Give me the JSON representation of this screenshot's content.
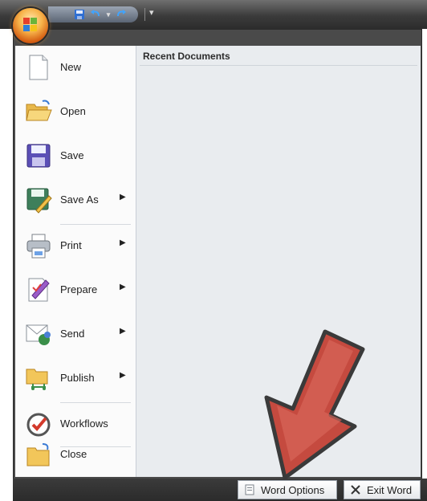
{
  "window": {
    "title": ""
  },
  "quick_access": {
    "items": [
      {
        "icon": "save-icon"
      },
      {
        "icon": "undo-icon"
      },
      {
        "icon": "undo-dropdown-icon"
      },
      {
        "icon": "redo-icon"
      },
      {
        "icon": "customize-qat-icon"
      }
    ]
  },
  "menu": {
    "items": [
      {
        "label": "New",
        "icon": "new-document-icon",
        "submenu": false
      },
      {
        "label": "Open",
        "icon": "open-folder-icon",
        "submenu": false
      },
      {
        "label": "Save",
        "icon": "save-disk-icon",
        "submenu": false
      },
      {
        "label": "Save As",
        "icon": "save-as-icon",
        "submenu": true
      },
      {
        "label": "Print",
        "icon": "printer-icon",
        "submenu": true
      },
      {
        "label": "Prepare",
        "icon": "prepare-icon",
        "submenu": true
      },
      {
        "label": "Send",
        "icon": "send-icon",
        "submenu": true
      },
      {
        "label": "Publish",
        "icon": "publish-icon",
        "submenu": true
      },
      {
        "label": "Workflows",
        "icon": "workflows-icon",
        "submenu": false
      },
      {
        "label": "Close",
        "icon": "close-folder-icon",
        "submenu": false
      }
    ],
    "submenu_arrow": "▶"
  },
  "recent": {
    "title": "Recent Documents"
  },
  "footer": {
    "word_options": "Word Options",
    "exit_word": "Exit Word"
  },
  "colors": {
    "titlebar": "#3b3b3b",
    "menu_left": "#fbfbfb",
    "menu_right": "#e9ecef",
    "arrow_fill": "#c54a3f",
    "arrow_outline": "#3a3a3a"
  }
}
